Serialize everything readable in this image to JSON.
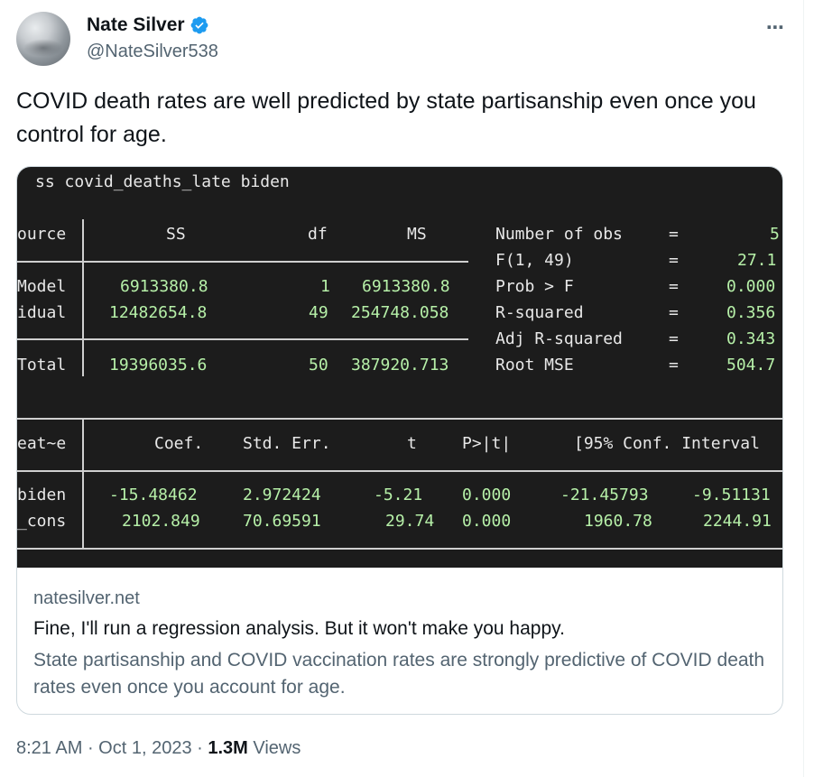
{
  "author": {
    "name": "Nate Silver",
    "handle": "@NateSilver538",
    "verified": true
  },
  "more_icon": "⋯",
  "tweet_text": "COVID death rates are well predicted by state partisanship even once you control for age.",
  "terminal": {
    "command": "ss covid_deaths_late biden",
    "anova_header": {
      "source": "ource",
      "ss": "SS",
      "df": "df",
      "ms": "MS"
    },
    "rows": [
      {
        "source": "Model",
        "ss": "6913380.8",
        "df": "1",
        "ms": "6913380.8"
      },
      {
        "source": "idual",
        "ss": "12482654.8",
        "df": "49",
        "ms": "254748.058"
      },
      {
        "source": "Total",
        "ss": "19396035.6",
        "df": "50",
        "ms": "387920.713"
      }
    ],
    "stats": [
      {
        "label": "Number of obs",
        "eq": "=",
        "value": "5"
      },
      {
        "label": "F(1, 49)",
        "eq": "=",
        "value": "27.1"
      },
      {
        "label": "Prob > F",
        "eq": "=",
        "value": "0.000"
      },
      {
        "label": "R-squared",
        "eq": "=",
        "value": "0.356"
      },
      {
        "label": "Adj R-squared",
        "eq": "=",
        "value": "0.343"
      },
      {
        "label": "Root MSE",
        "eq": "=",
        "value": "504.7"
      }
    ],
    "coef_header": {
      "var": "eat~e",
      "coef": "Coef.",
      "se": "Std. Err.",
      "t": "t",
      "p": "P>|t|",
      "ci": "[95% Conf. Interval"
    },
    "coef_rows": [
      {
        "var": "biden",
        "coef": "-15.48462",
        "se": "2.972424",
        "t": "-5.21",
        "p": "0.000",
        "lo": "-21.45793",
        "hi": "-9.51131"
      },
      {
        "var": "_cons",
        "coef": "2102.849",
        "se": "70.69591",
        "t": "29.74",
        "p": "0.000",
        "lo": "1960.78",
        "hi": "2244.91"
      }
    ]
  },
  "card": {
    "domain": "natesilver.net",
    "title": "Fine, I'll run a regression analysis. But it won't make you happy.",
    "description": "State partisanship and COVID vaccination rates are strongly predictive of COVID death rates even once you account for age."
  },
  "footer": {
    "time": "8:21 AM",
    "sep1": " · ",
    "date": "Oct 1, 2023",
    "sep2": " · ",
    "views_count": "1.3M",
    "views_label": " Views"
  },
  "colors": {
    "accent": "#1d9bf0",
    "terminal_bg": "#1c1c1c",
    "number_green": "#b6f0a8"
  }
}
